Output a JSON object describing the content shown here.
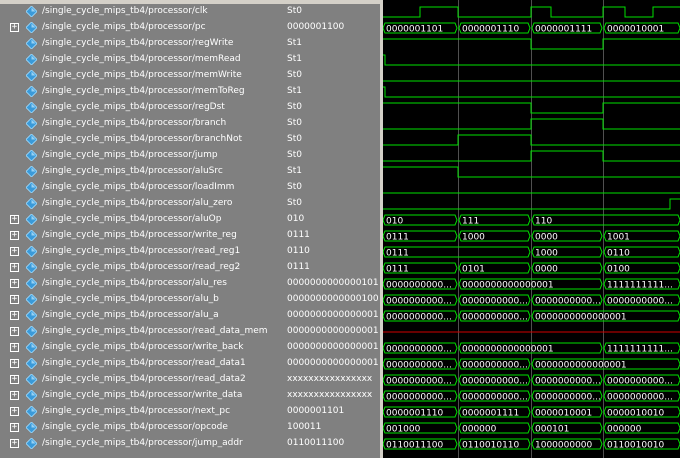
{
  "signals": [
    {
      "name": "/single_cycle_mips_tb4/processor/clk",
      "value": "St0",
      "expand": false,
      "wave": {
        "type": "bit",
        "t": [
          0,
          37,
          75,
          148,
          168,
          220,
          242,
          270
        ],
        "v": [
          0,
          1,
          0,
          1,
          0,
          1,
          0,
          1
        ]
      }
    },
    {
      "name": "/single_cycle_mips_tb4/processor/pc",
      "value": "0000001100",
      "expand": true,
      "wave": {
        "type": "bus",
        "t": [
          0,
          75,
          148,
          220
        ],
        "labels": [
          "0000001101",
          "0000001110",
          "0000001111",
          "0000010001"
        ]
      }
    },
    {
      "name": "/single_cycle_mips_tb4/processor/regWrite",
      "value": "St1",
      "expand": false,
      "wave": {
        "type": "bit",
        "t": [
          0,
          148,
          220
        ],
        "v": [
          1,
          0,
          1
        ]
      }
    },
    {
      "name": "/single_cycle_mips_tb4/processor/memRead",
      "value": "St1",
      "expand": false,
      "wave": {
        "type": "bit",
        "t": [
          0,
          2
        ],
        "v": [
          1,
          0
        ]
      }
    },
    {
      "name": "/single_cycle_mips_tb4/processor/memWrite",
      "value": "St0",
      "expand": false,
      "wave": {
        "type": "bit",
        "t": [
          0
        ],
        "v": [
          0
        ]
      }
    },
    {
      "name": "/single_cycle_mips_tb4/processor/memToReg",
      "value": "St1",
      "expand": false,
      "wave": {
        "type": "bit",
        "t": [
          0,
          2
        ],
        "v": [
          1,
          0
        ]
      }
    },
    {
      "name": "/single_cycle_mips_tb4/processor/regDst",
      "value": "St0",
      "expand": false,
      "wave": {
        "type": "bit",
        "t": [
          0,
          75,
          148,
          220
        ],
        "v": [
          1,
          1,
          0,
          1
        ]
      }
    },
    {
      "name": "/single_cycle_mips_tb4/processor/branch",
      "value": "St0",
      "expand": false,
      "wave": {
        "type": "bit",
        "t": [
          0,
          148,
          220
        ],
        "v": [
          0,
          1,
          0
        ]
      }
    },
    {
      "name": "/single_cycle_mips_tb4/processor/branchNot",
      "value": "St0",
      "expand": false,
      "wave": {
        "type": "bit",
        "t": [
          0,
          75,
          148
        ],
        "v": [
          0,
          1,
          0
        ]
      }
    },
    {
      "name": "/single_cycle_mips_tb4/processor/jump",
      "value": "St0",
      "expand": false,
      "wave": {
        "type": "bit",
        "t": [
          0,
          148,
          220
        ],
        "v": [
          0,
          1,
          0
        ]
      }
    },
    {
      "name": "/single_cycle_mips_tb4/processor/aluSrc",
      "value": "St1",
      "expand": false,
      "wave": {
        "type": "bit",
        "t": [
          0,
          75
        ],
        "v": [
          1,
          0
        ]
      }
    },
    {
      "name": "/single_cycle_mips_tb4/processor/loadImm",
      "value": "St0",
      "expand": false,
      "wave": {
        "type": "bit",
        "t": [
          0
        ],
        "v": [
          0
        ]
      }
    },
    {
      "name": "/single_cycle_mips_tb4/processor/alu_zero",
      "value": "St0",
      "expand": false,
      "wave": {
        "type": "bit",
        "t": [
          0,
          287
        ],
        "v": [
          0,
          1
        ]
      }
    },
    {
      "name": "/single_cycle_mips_tb4/processor/aluOp",
      "value": "010",
      "expand": true,
      "wave": {
        "type": "bus",
        "t": [
          0,
          75,
          148
        ],
        "labels": [
          "010",
          "111",
          "110"
        ]
      }
    },
    {
      "name": "/single_cycle_mips_tb4/processor/write_reg",
      "value": "0111",
      "expand": true,
      "wave": {
        "type": "bus",
        "t": [
          0,
          75,
          148,
          220
        ],
        "labels": [
          "0111",
          "1000",
          "0000",
          "1001"
        ]
      }
    },
    {
      "name": "/single_cycle_mips_tb4/processor/read_reg1",
      "value": "0110",
      "expand": true,
      "wave": {
        "type": "bus",
        "t": [
          0,
          148,
          220
        ],
        "labels": [
          "0111",
          "1000",
          "0110"
        ]
      }
    },
    {
      "name": "/single_cycle_mips_tb4/processor/read_reg2",
      "value": "0111",
      "expand": true,
      "wave": {
        "type": "bus",
        "t": [
          0,
          75,
          148,
          220
        ],
        "labels": [
          "0111",
          "0101",
          "0000",
          "0100"
        ]
      }
    },
    {
      "name": "/single_cycle_mips_tb4/processor/alu_res",
      "value": "0000000000000101",
      "expand": true,
      "wave": {
        "type": "bus",
        "t": [
          0,
          75,
          220
        ],
        "labels": [
          "0000000000...",
          "0000000000000001",
          "1111111111..."
        ]
      }
    },
    {
      "name": "/single_cycle_mips_tb4/processor/alu_b",
      "value": "0000000000000100",
      "expand": true,
      "wave": {
        "type": "bus",
        "t": [
          0,
          75,
          148,
          220
        ],
        "labels": [
          "0000000000...",
          "0000000000...",
          "0000000000...",
          "0000000000..."
        ]
      }
    },
    {
      "name": "/single_cycle_mips_tb4/processor/alu_a",
      "value": "0000000000000001",
      "expand": true,
      "wave": {
        "type": "bus",
        "t": [
          0,
          75,
          148
        ],
        "labels": [
          "0000000000...",
          "0000000000...",
          "0000000000000001"
        ]
      }
    },
    {
      "name": "/single_cycle_mips_tb4/processor/read_data_mem",
      "value": "0000000000000001",
      "expand": true,
      "wave": {
        "type": "busx",
        "t": [
          0
        ],
        "labels": [
          ""
        ]
      }
    },
    {
      "name": "/single_cycle_mips_tb4/processor/write_back",
      "value": "0000000000000001",
      "expand": true,
      "wave": {
        "type": "bus",
        "t": [
          0,
          75,
          220
        ],
        "labels": [
          "0000000000...",
          "0000000000000001",
          "1111111111..."
        ]
      }
    },
    {
      "name": "/single_cycle_mips_tb4/processor/read_data1",
      "value": "0000000000000001",
      "expand": true,
      "wave": {
        "type": "bus",
        "t": [
          0,
          75,
          148
        ],
        "labels": [
          "0000000000...",
          "0000000000...",
          "0000000000000001"
        ]
      }
    },
    {
      "name": "/single_cycle_mips_tb4/processor/read_data2",
      "value": "xxxxxxxxxxxxxxxx",
      "expand": true,
      "wave": {
        "type": "bus",
        "t": [
          0,
          75,
          148,
          220
        ],
        "labels": [
          "0000000000...",
          "0000000000...",
          "0000000000...",
          "0000000000..."
        ]
      }
    },
    {
      "name": "/single_cycle_mips_tb4/processor/write_data",
      "value": "xxxxxxxxxxxxxxxx",
      "expand": true,
      "wave": {
        "type": "bus",
        "t": [
          0,
          75,
          148,
          220
        ],
        "labels": [
          "0000000000...",
          "0000000000...",
          "0000000000...",
          "0000000000..."
        ]
      }
    },
    {
      "name": "/single_cycle_mips_tb4/processor/next_pc",
      "value": "0000001101",
      "expand": true,
      "wave": {
        "type": "bus",
        "t": [
          0,
          75,
          148,
          220
        ],
        "labels": [
          "0000001110",
          "0000001111",
          "0000010001",
          "0000010010"
        ]
      }
    },
    {
      "name": "/single_cycle_mips_tb4/processor/opcode",
      "value": "100011",
      "expand": true,
      "wave": {
        "type": "bus",
        "t": [
          0,
          75,
          148,
          220
        ],
        "labels": [
          "001000",
          "000000",
          "000101",
          "000000"
        ]
      }
    },
    {
      "name": "/single_cycle_mips_tb4/processor/jump_addr",
      "value": "0110011100",
      "expand": true,
      "wave": {
        "type": "bus",
        "t": [
          0,
          75,
          148,
          220
        ],
        "labels": [
          "0110011100",
          "0110010110",
          "1000000000",
          "0110010010"
        ]
      }
    }
  ],
  "colors": {
    "wave": "#00e000",
    "bus": "#00e000",
    "cursor": "#ffffff",
    "grid": "#505050",
    "x_value": "#d00000"
  }
}
